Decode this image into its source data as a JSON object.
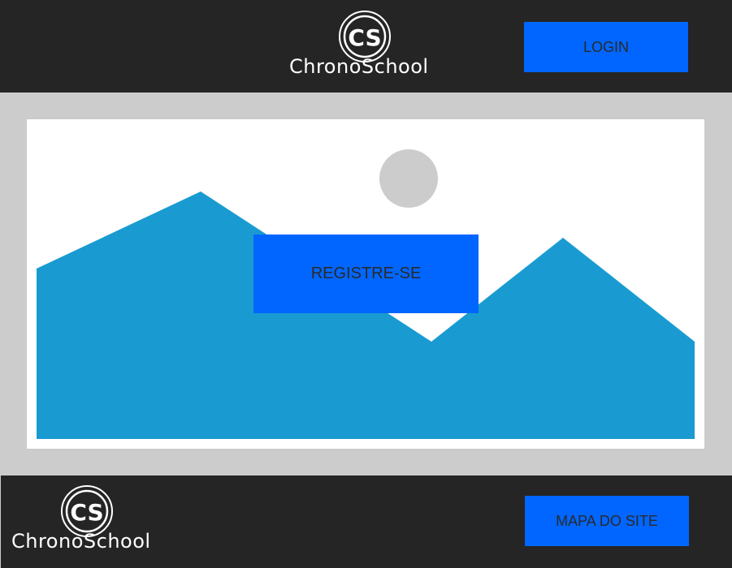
{
  "header": {
    "logo_monogram": "CS",
    "logo_text": "ChronoSchool",
    "login_label": "LOGIN"
  },
  "hero": {
    "register_label": "REGISTRE-SE",
    "image_placeholder": "image-placeholder-icon"
  },
  "footer": {
    "logo_monogram": "CS",
    "logo_text": "ChronoSchool",
    "sitemap_label": "MAPA DO SITE"
  },
  "colors": {
    "bar": "#252525",
    "background": "#cccccc",
    "accent": "#0066ff",
    "mountain": "#199bd1"
  }
}
